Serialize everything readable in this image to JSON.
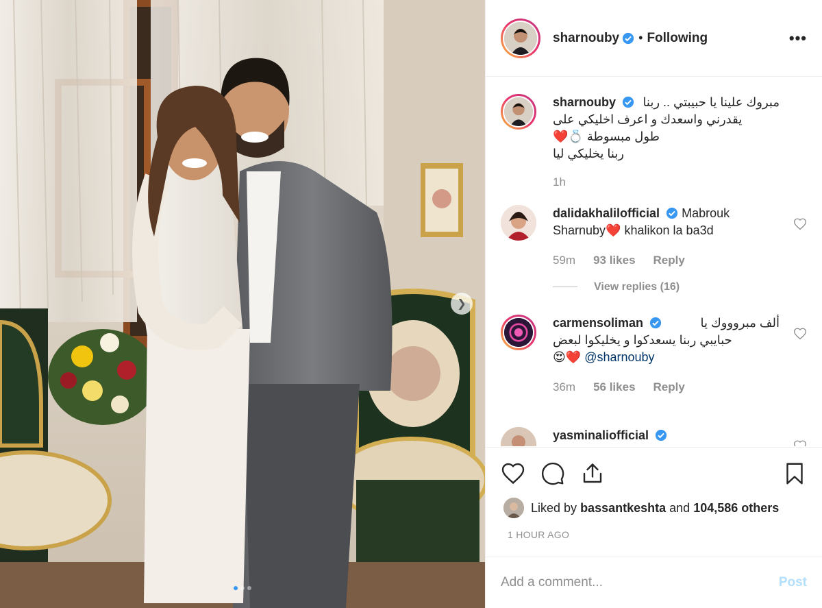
{
  "header": {
    "username": "sharnouby",
    "separator": "•",
    "follow_status": "Following",
    "more": "•••"
  },
  "caption": {
    "username": "sharnouby",
    "line1": "مبروك علينا يا حبيبتي .. ربنا",
    "line2": "يقدرني واسعدك و اعرف اخليكي على",
    "line3": "طول مبسوطة",
    "line4": "ربنا يخليكي ليا",
    "emoji": "❤️💍",
    "time": "1h"
  },
  "comments": [
    {
      "username": "dalidakhalilofficial",
      "text_before": "Mabrouk Sharnuby",
      "emoji": "❤️",
      "text_after": "khalikon la ba3d",
      "time": "59m",
      "likes": "93 likes",
      "reply": "Reply",
      "view_replies": "View replies (16)"
    },
    {
      "username": "carmensoliman",
      "text_line1": "ألف مبروووك يا",
      "text_line2": "حبايبي ربنا يسعدكوا و يخليكوا لبعض",
      "emoji": "😍❤️",
      "mention": "@sharnouby",
      "time": "36m",
      "likes": "56 likes",
      "reply": "Reply"
    },
    {
      "username": "yasminaliofficial"
    }
  ],
  "likes": {
    "prefix": "Liked by",
    "user": "bassantkeshta",
    "middle": "and",
    "others": "104,586 others"
  },
  "timestamp": "1 HOUR AGO",
  "add_comment": {
    "placeholder": "Add a comment...",
    "post_label": "Post"
  },
  "colors": {
    "verified": "#3897f0",
    "heart": "#ed4956",
    "link": "#003569",
    "post_disabled": "#b2dffc"
  }
}
